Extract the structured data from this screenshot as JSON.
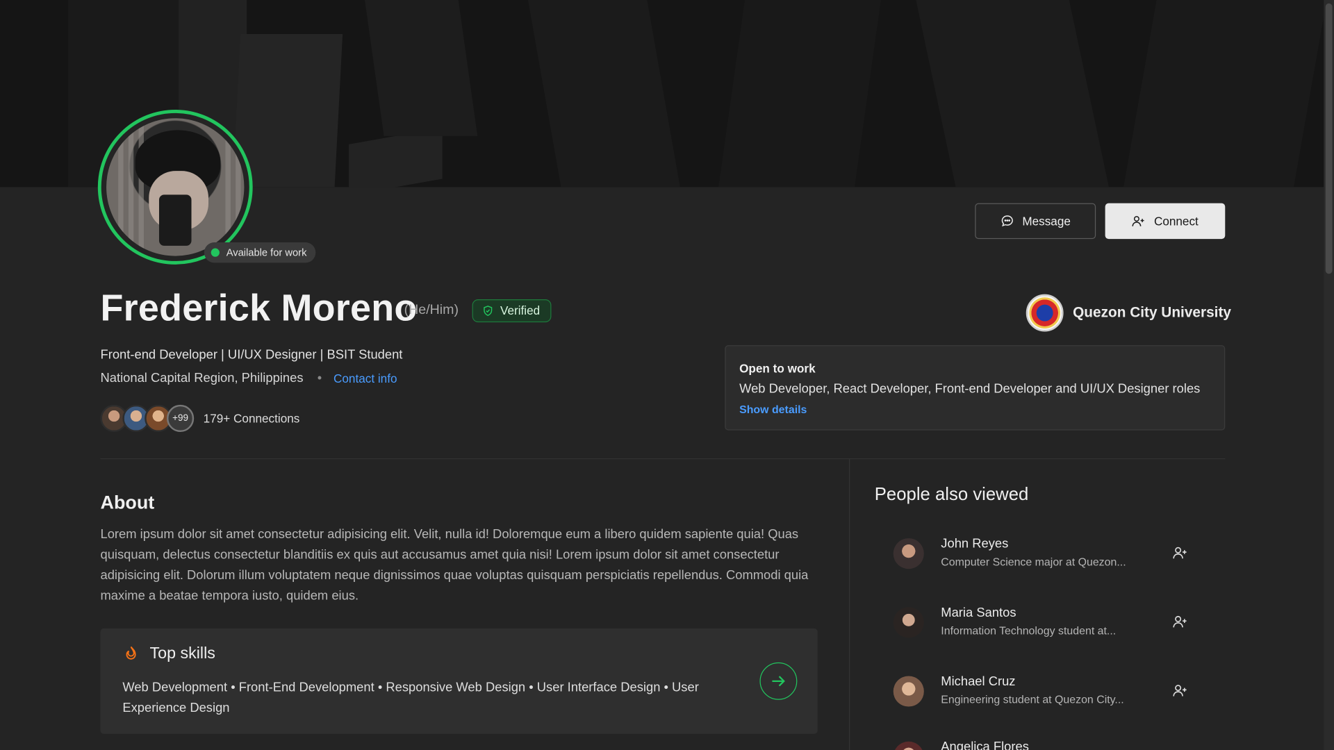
{
  "profile": {
    "name": "Frederick Moreno",
    "pronouns": "(He/Him)",
    "verified_label": "Verified",
    "status": "Available for work",
    "headline": "Front-end Developer | UI/UX Designer | BSIT Student",
    "location": "National Capital Region, Philippines",
    "bullet": "•",
    "contact_link": "Contact info",
    "connections_more": "+99",
    "connections_label": "179+ Connections"
  },
  "actions": {
    "message_label": "Message",
    "connect_label": "Connect"
  },
  "education": {
    "university": "Quezon City University"
  },
  "open_to_work": {
    "title": "Open to work",
    "roles": "Web Developer, React Developer, Front-end Developer and UI/UX Designer roles",
    "show_details": "Show details"
  },
  "about": {
    "title": "About",
    "text": "Lorem ipsum dolor sit amet consectetur adipisicing elit. Velit, nulla id! Doloremque eum a libero quidem sapiente quia! Quas quisquam, delectus consectetur blanditiis ex quis aut accusamus amet quia nisi! Lorem ipsum dolor sit amet consectetur adipisicing elit. Dolorum illum voluptatem neque dignissimos quae voluptas quisquam perspiciatis repellendus. Commodi quia maxime a beatae tempora iusto, quidem eius."
  },
  "skills": {
    "title": "Top skills",
    "list": "Web Development • Front-End Development • Responsive Web Design • User Interface Design • User Experience Design"
  },
  "people_also_viewed": {
    "title": "People also viewed",
    "people": [
      {
        "name": "John Reyes",
        "desc": "Computer Science major at Quezon..."
      },
      {
        "name": "Maria Santos",
        "desc": "Information Technology student at..."
      },
      {
        "name": "Michael Cruz",
        "desc": "Engineering student at Quezon City..."
      },
      {
        "name": "Angelica Flores",
        "desc": ""
      }
    ]
  },
  "colors": {
    "accent_green": "#22c55e",
    "link_blue": "#4a9cff",
    "background": "#242424"
  },
  "icons": [
    "message-icon",
    "add-user-icon",
    "shield-check-icon",
    "flame-icon",
    "arrow-right-icon",
    "university-logo"
  ]
}
